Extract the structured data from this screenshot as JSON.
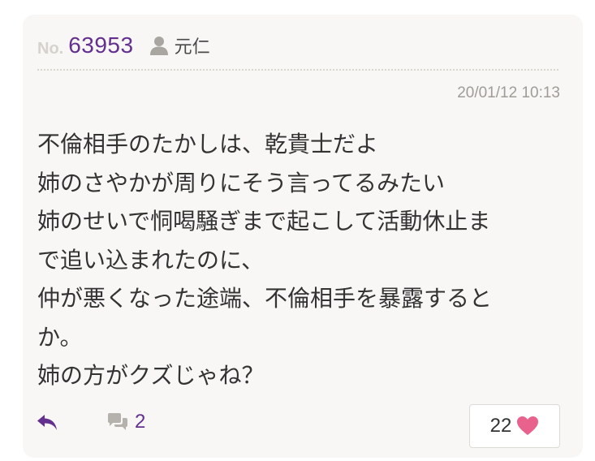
{
  "post": {
    "number_prefix": "No.",
    "number": "63953",
    "user_icon": "user-icon",
    "username": "元仁",
    "timestamp": "20/01/12 10:13",
    "body_lines": [
      "不倫相手のたかしは、乾貴士だよ",
      "姉のさやかが周りにそう言ってるみたい",
      "姉のせいで恫喝騒ぎまで起こして活動休止ま",
      "で追い込まれたのに、",
      "仲が悪くなった途端、不倫相手を暴露すると",
      "か。",
      "姉の方がクズじゃね？"
    ]
  },
  "footer": {
    "reply_icon": "reply-icon",
    "comment_icon": "comment-icon",
    "comment_count": "2",
    "like_count": "22",
    "like_icon": "heart-icon"
  },
  "colors": {
    "accent_purple": "#63308f",
    "heart_pink": "#e9628d",
    "card_background": "#f8f7f5",
    "muted_gray": "#9f9c97"
  }
}
